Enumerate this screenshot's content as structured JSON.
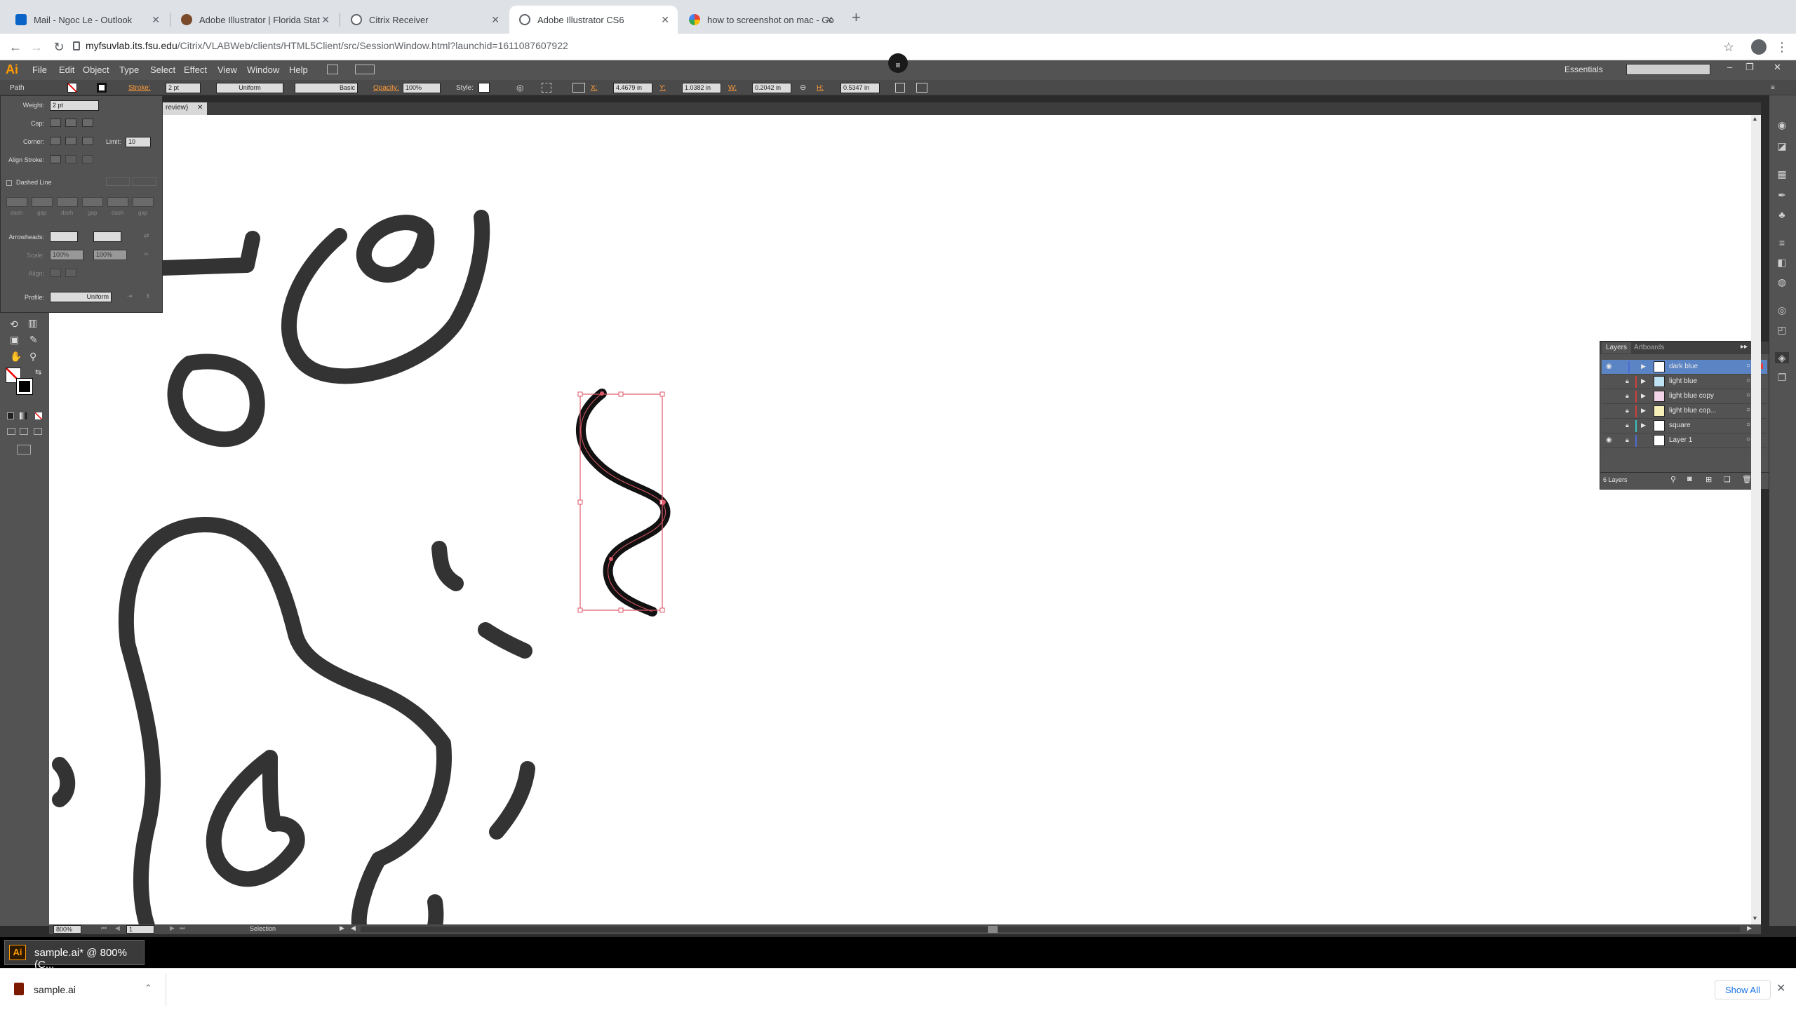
{
  "browser": {
    "tabs": [
      {
        "label": "Mail - Ngoc Le - Outlook",
        "active": false
      },
      {
        "label": "Adobe Illustrator | Florida Stat",
        "active": false
      },
      {
        "label": "Citrix Receiver",
        "active": false
      },
      {
        "label": "Adobe Illustrator CS6",
        "active": true
      },
      {
        "label": "how to screenshot on mac - Go",
        "active": false
      }
    ],
    "url_host": "myfsuvlab.its.fsu.edu",
    "url_path": "/Citrix/VLABWeb/clients/HTML5Client/src/SessionWindow.html?launchid=1611087607922"
  },
  "illustrator": {
    "app_logo": "Ai",
    "menus": [
      "File",
      "Edit",
      "Object",
      "Type",
      "Select",
      "Effect",
      "View",
      "Window",
      "Help"
    ],
    "workspace": "Essentials",
    "control_bar": {
      "selection_type": "Path",
      "stroke_label": "Stroke:",
      "stroke_weight": "2 pt",
      "profile_uniform": "Uniform",
      "brush_basic": "Basic",
      "opacity_label": "Opacity:",
      "opacity_value": "100%",
      "style_label": "Style:",
      "x_label": "X:",
      "x_value": "4.4679 in",
      "y_label": "Y:",
      "y_value": "1.0382 in",
      "w_label": "W:",
      "w_value": "0.2042 in",
      "h_label": "H:",
      "h_value": "0.5347 in"
    },
    "doc_tab_suffix": "review)",
    "stroke_panel": {
      "weight_label": "Weight:",
      "weight_value": "2 pt",
      "cap_label": "Cap:",
      "corner_label": "Corner:",
      "limit_label": "Limit:",
      "limit_value": "10",
      "align_label": "Align Stroke:",
      "dashed_label": "Dashed Line",
      "dash_labels": [
        "dash",
        "gap",
        "dash",
        "gap",
        "dash",
        "gap"
      ],
      "arrowheads_label": "Arrowheads:",
      "scale_label": "Scale:",
      "scale_value_1": "100%",
      "scale_value_2": "100%",
      "align_arrow_label": "Align:",
      "profile_label": "Profile:",
      "profile_value": "Uniform"
    },
    "layers_panel": {
      "tab_layers": "Layers",
      "tab_artboards": "Artboards",
      "layers": [
        {
          "name": "dark blue",
          "visible": true,
          "locked": false,
          "color": "#4f6bd6",
          "selected": true
        },
        {
          "name": "light blue",
          "visible": false,
          "locked": true,
          "color": "#d04040",
          "selected": false
        },
        {
          "name": "light blue copy",
          "visible": false,
          "locked": true,
          "color": "#d04040",
          "selected": false
        },
        {
          "name": "light blue cop...",
          "visible": false,
          "locked": true,
          "color": "#d04040",
          "selected": false
        },
        {
          "name": "square",
          "visible": false,
          "locked": true,
          "color": "#3ac0c0",
          "selected": false
        },
        {
          "name": "Layer 1",
          "visible": true,
          "locked": true,
          "color": "#4f6bd6",
          "selected": false
        }
      ],
      "footer_count": "6 Layers"
    },
    "status": {
      "zoom": "800%",
      "page": "1",
      "tool": "Selection"
    }
  },
  "taskbar": {
    "app_label": "sample.ai* @ 800% (C..."
  },
  "downloads": {
    "file_name": "sample.ai",
    "show_all": "Show All"
  }
}
